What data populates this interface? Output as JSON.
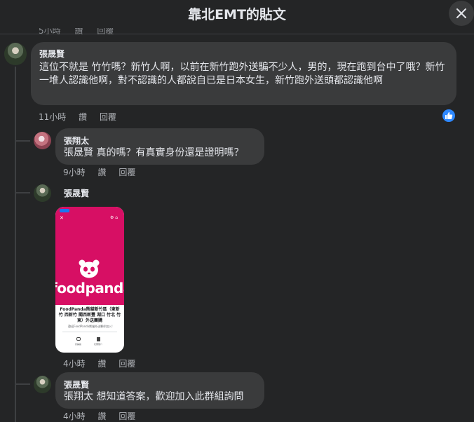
{
  "header": {
    "title": "靠北EMT的貼文"
  },
  "cut_row": {
    "time": "5小時",
    "like": "讚",
    "reply": "回覆"
  },
  "comments": [
    {
      "author": "張晟賢",
      "text": "這位不就是 竹竹嗎？新竹人啊，以前在新竹跑外送騙不少人，男的，現在跑到台中了哦？新竹一堆人認識他啊，對不認識的人都說自已是日本女生，新竹跑外送頭都認識他啊",
      "time": "11小時",
      "like": "讚",
      "reply": "回覆",
      "reaction_icon": "like-icon"
    }
  ],
  "replies": [
    {
      "author": "張翔太",
      "text": "張晟賢 真的嗎？有真實身份還是證明嗎？",
      "time": "9小時",
      "like": "讚",
      "reply": "回覆"
    },
    {
      "author": "張晟賢",
      "time": "4小時",
      "like": "讚",
      "reply": "回覆",
      "image": {
        "brand": "foodpanda",
        "title": "FoodPanda熊貓新竹區（東新竹 西新竹 關西新豐 湖口 竹北 竹東）外送團購",
        "subtitle": "歡迎FoodPanda熊貓外送夥伴加入!",
        "btn_a": "討論區",
        "btn_b": "社團簡介",
        "accent": "#d70f64"
      }
    },
    {
      "author": "張晟賢",
      "text": "張翔太 想知道答案，歡迎加入此群組詢問",
      "time": "4小時",
      "like": "讚",
      "reply": "回覆"
    }
  ],
  "colors": {
    "background": "#242526",
    "bubble": "#3a3b3c",
    "like_blue": "#2d88ff"
  }
}
